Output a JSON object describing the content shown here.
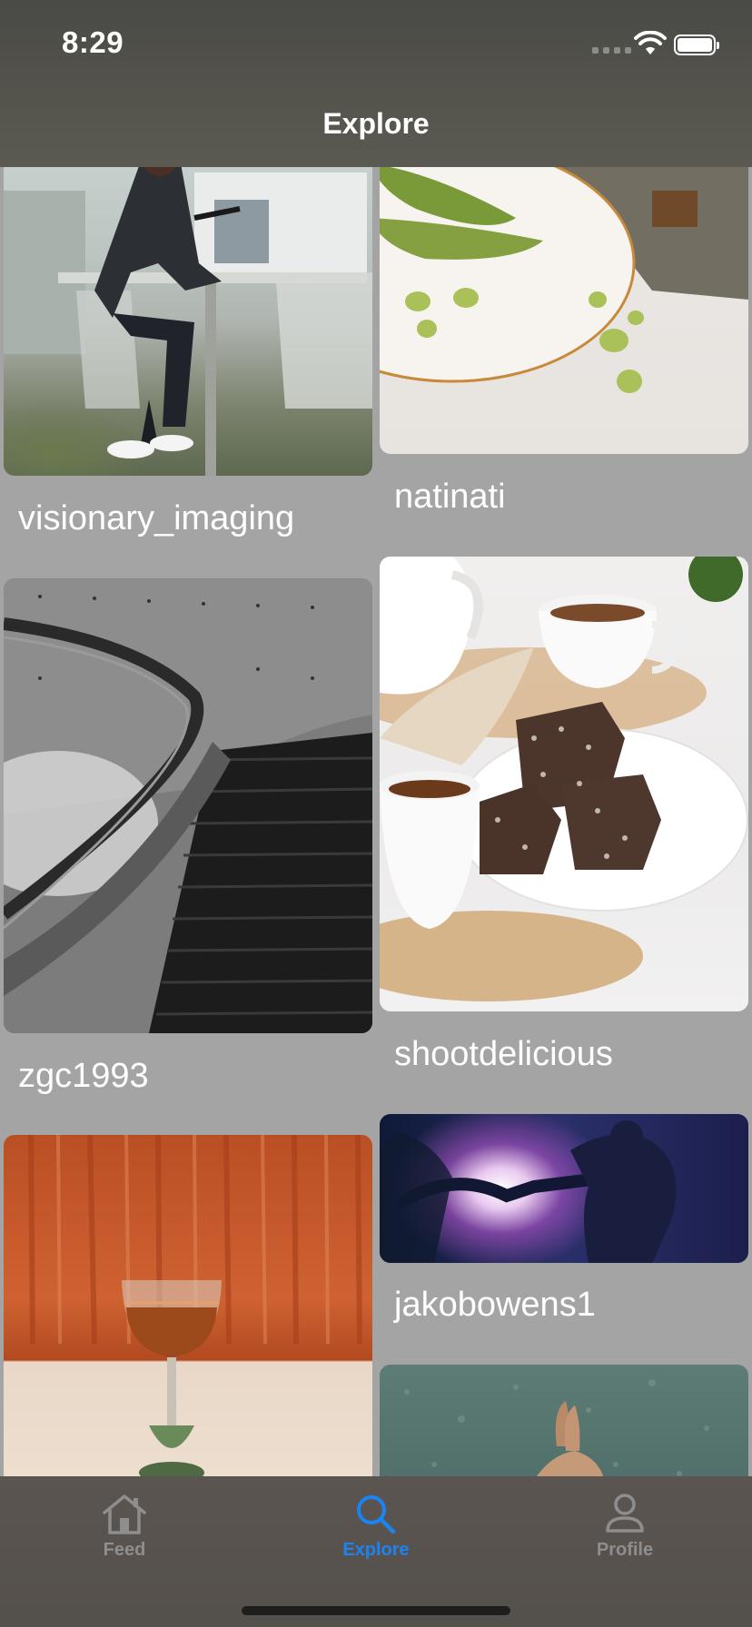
{
  "status_bar": {
    "time": "8:29"
  },
  "nav": {
    "title": "Explore"
  },
  "grid": {
    "left_column": [
      {
        "username": "visionary_imaging"
      },
      {
        "username": "zgc1993"
      },
      {
        "username": ""
      }
    ],
    "right_column": [
      {
        "username": "natinati"
      },
      {
        "username": "shootdelicious"
      },
      {
        "username": "jakobowens1"
      },
      {
        "username": ""
      }
    ]
  },
  "tabs": [
    {
      "label": "Feed",
      "icon": "house-icon",
      "active": false,
      "color": "#8e8e8e"
    },
    {
      "label": "Explore",
      "icon": "magnifying-glass-icon",
      "active": true,
      "color": "#1a84f2"
    },
    {
      "label": "Profile",
      "icon": "person-icon",
      "active": false,
      "color": "#8e8e8e"
    }
  ],
  "colors": {
    "accent": "#1a84f2",
    "inactive": "#8e8e8e",
    "background": "#a4a4a4"
  }
}
